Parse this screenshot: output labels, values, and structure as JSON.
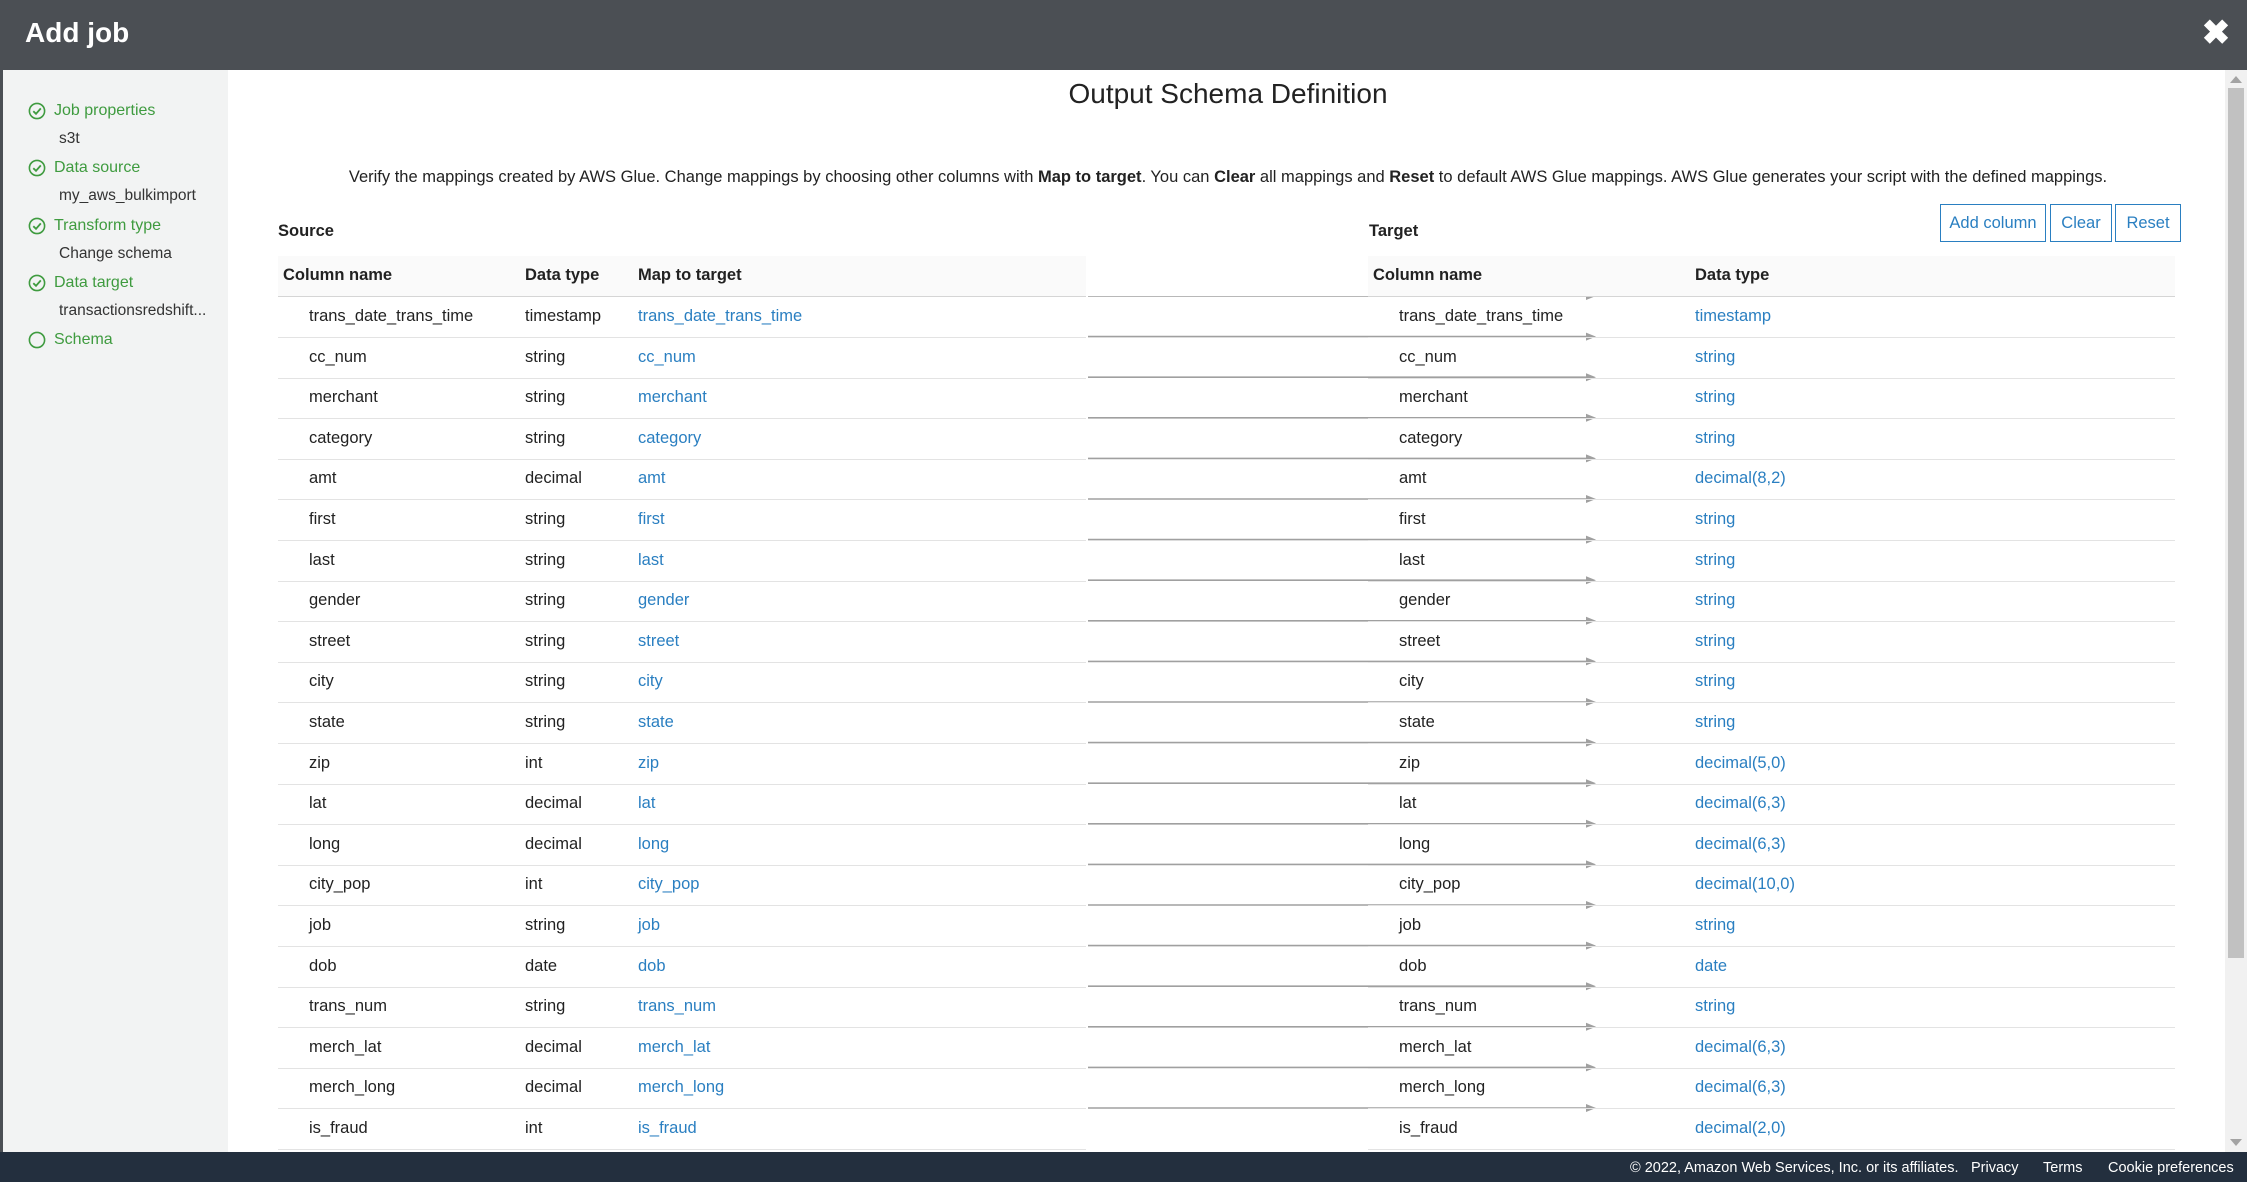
{
  "header": {
    "title": "Add job",
    "close_icon": "close-icon"
  },
  "sidebar": {
    "steps": [
      {
        "label": "Job properties",
        "value": "s3t",
        "done": true
      },
      {
        "label": "Data source",
        "value": "my_aws_bulkimport",
        "done": true
      },
      {
        "label": "Transform type",
        "value": "Change schema",
        "done": true
      },
      {
        "label": "Data target",
        "value": "transactionsredshift...",
        "done": true
      },
      {
        "label": "Schema",
        "value": "",
        "done": false
      }
    ]
  },
  "main": {
    "title": "Output Schema Definition",
    "description": {
      "part1": "Verify the mappings created by AWS Glue. Change mappings by choosing other columns with ",
      "bold1": "Map to target",
      "part2": ". You can ",
      "bold2": "Clear",
      "part3": " all mappings and ",
      "bold3": "Reset",
      "part4": " to default AWS Glue mappings. AWS Glue generates your script with the defined mappings."
    },
    "source_label": "Source",
    "target_label": "Target",
    "buttons": {
      "add_column": "Add column",
      "clear": "Clear",
      "reset": "Reset"
    },
    "source_headers": {
      "column_name": "Column name",
      "data_type": "Data type",
      "map_to_target": "Map to target"
    },
    "target_headers": {
      "column_name": "Column name",
      "data_type": "Data type"
    },
    "rows": [
      {
        "src": "trans_date_trans_time",
        "src_type": "timestamp",
        "map": "trans_date_trans_time",
        "tgt": "trans_date_trans_time",
        "tgt_type": "timestamp"
      },
      {
        "src": "cc_num",
        "src_type": "string",
        "map": "cc_num",
        "tgt": "cc_num",
        "tgt_type": "string"
      },
      {
        "src": "merchant",
        "src_type": "string",
        "map": "merchant",
        "tgt": "merchant",
        "tgt_type": "string"
      },
      {
        "src": "category",
        "src_type": "string",
        "map": "category",
        "tgt": "category",
        "tgt_type": "string"
      },
      {
        "src": "amt",
        "src_type": "decimal",
        "map": "amt",
        "tgt": "amt",
        "tgt_type": "decimal(8,2)"
      },
      {
        "src": "first",
        "src_type": "string",
        "map": "first",
        "tgt": "first",
        "tgt_type": "string"
      },
      {
        "src": "last",
        "src_type": "string",
        "map": "last",
        "tgt": "last",
        "tgt_type": "string"
      },
      {
        "src": "gender",
        "src_type": "string",
        "map": "gender",
        "tgt": "gender",
        "tgt_type": "string"
      },
      {
        "src": "street",
        "src_type": "string",
        "map": "street",
        "tgt": "street",
        "tgt_type": "string"
      },
      {
        "src": "city",
        "src_type": "string",
        "map": "city",
        "tgt": "city",
        "tgt_type": "string"
      },
      {
        "src": "state",
        "src_type": "string",
        "map": "state",
        "tgt": "state",
        "tgt_type": "string"
      },
      {
        "src": "zip",
        "src_type": "int",
        "map": "zip",
        "tgt": "zip",
        "tgt_type": "decimal(5,0)"
      },
      {
        "src": "lat",
        "src_type": "decimal",
        "map": "lat",
        "tgt": "lat",
        "tgt_type": "decimal(6,3)"
      },
      {
        "src": "long",
        "src_type": "decimal",
        "map": "long",
        "tgt": "long",
        "tgt_type": "decimal(6,3)"
      },
      {
        "src": "city_pop",
        "src_type": "int",
        "map": "city_pop",
        "tgt": "city_pop",
        "tgt_type": "decimal(10,0)"
      },
      {
        "src": "job",
        "src_type": "string",
        "map": "job",
        "tgt": "job",
        "tgt_type": "string"
      },
      {
        "src": "dob",
        "src_type": "date",
        "map": "dob",
        "tgt": "dob",
        "tgt_type": "date"
      },
      {
        "src": "trans_num",
        "src_type": "string",
        "map": "trans_num",
        "tgt": "trans_num",
        "tgt_type": "string"
      },
      {
        "src": "merch_lat",
        "src_type": "decimal",
        "map": "merch_lat",
        "tgt": "merch_lat",
        "tgt_type": "decimal(6,3)"
      },
      {
        "src": "merch_long",
        "src_type": "decimal",
        "map": "merch_long",
        "tgt": "merch_long",
        "tgt_type": "decimal(6,3)"
      },
      {
        "src": "is_fraud",
        "src_type": "int",
        "map": "is_fraud",
        "tgt": "is_fraud",
        "tgt_type": "decimal(2,0)"
      }
    ]
  },
  "footer": {
    "copyright": "© 2022, Amazon Web Services, Inc. or its affiliates.",
    "privacy": "Privacy",
    "terms": "Terms",
    "cookies": "Cookie preferences"
  },
  "colors": {
    "header_bg": "#4b4f54",
    "success": "#3f9b3f",
    "link": "#2a7fc1",
    "footer_bg": "#232f3e"
  }
}
